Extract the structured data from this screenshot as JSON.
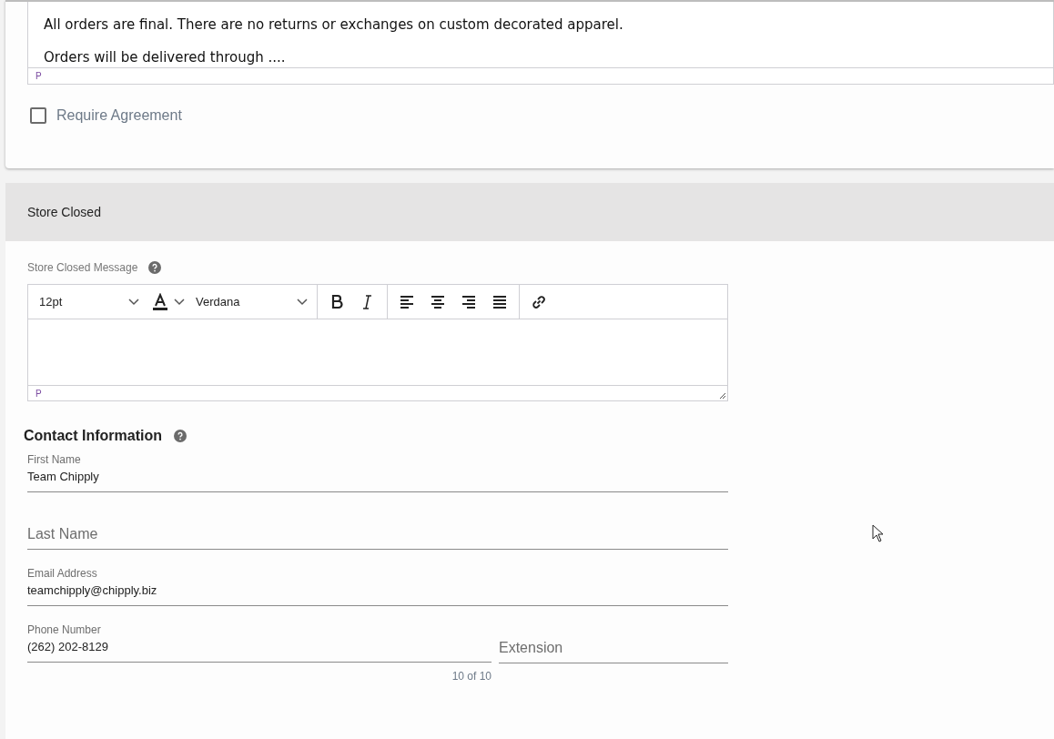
{
  "terms_card": {
    "editor_lines": [
      "All orders are final. There are no returns or exchanges on custom decorated apparel.",
      "Orders will be delivered through ...."
    ],
    "editor_status": "P",
    "require_agreement": {
      "label": "Require Agreement",
      "checked": false
    }
  },
  "store_closed": {
    "title": "Store Closed",
    "message_label": "Store Closed Message",
    "toolbar": {
      "font_size": "12pt",
      "font_family": "Verdana"
    },
    "editor_status": "P"
  },
  "contact": {
    "title": "Contact Information",
    "fields": [
      {
        "label": "First Name",
        "value": "Team Chipply"
      },
      {
        "placeholder": "Last Name"
      },
      {
        "label": "Email Address",
        "value": "teamchipply@chipply.biz"
      }
    ],
    "phone": {
      "label": "Phone Number",
      "value": "(262) 202-8129",
      "counter": "10 of 10"
    },
    "extension": {
      "placeholder": "Extension"
    }
  }
}
